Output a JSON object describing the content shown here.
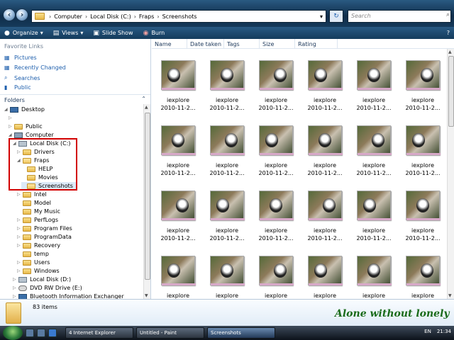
{
  "address": {
    "crumbs": [
      "Computer",
      "Local Disk (C:)",
      "Fraps",
      "Screenshots"
    ],
    "search_placeholder": "Search"
  },
  "toolbar": {
    "organize": "Organize",
    "views": "Views",
    "slideshow": "Slide Show",
    "burn": "Burn"
  },
  "sidebar": {
    "favorites_title": "Favorite Links",
    "favorites": [
      "Pictures",
      "Recently Changed",
      "Searches",
      "Public"
    ],
    "folders_title": "Folders",
    "tree": [
      "Desktop",
      "Public",
      "Computer",
      "Local Disk (C:)",
      "Drivers",
      "Fraps",
      "HELP",
      "Movies",
      "Screenshots",
      "Intel",
      "Model",
      "My Music",
      "PerfLogs",
      "Program Files",
      "ProgramData",
      "Recovery",
      "temp",
      "Users",
      "Windows",
      "Local Disk (D:)",
      "DVD RW Drive (E:)",
      "Bluetooth Information Exchanger"
    ]
  },
  "columns": [
    "Name",
    "Date taken",
    "Tags",
    "Size",
    "Rating"
  ],
  "files": {
    "name": "iexplore",
    "date": "2010-11-2..."
  },
  "status": {
    "count": "83 items"
  },
  "watermark": "Alone without lonely",
  "taskbar": {
    "tasks": [
      "4 Internet Explorer",
      "Untitled - Paint",
      "Screenshots"
    ],
    "lang": "EN",
    "time": "21:34"
  },
  "colors": {
    "accent": "#1e5fad",
    "highlight_box": "#d20000",
    "watermark": "#1a6b1a"
  }
}
